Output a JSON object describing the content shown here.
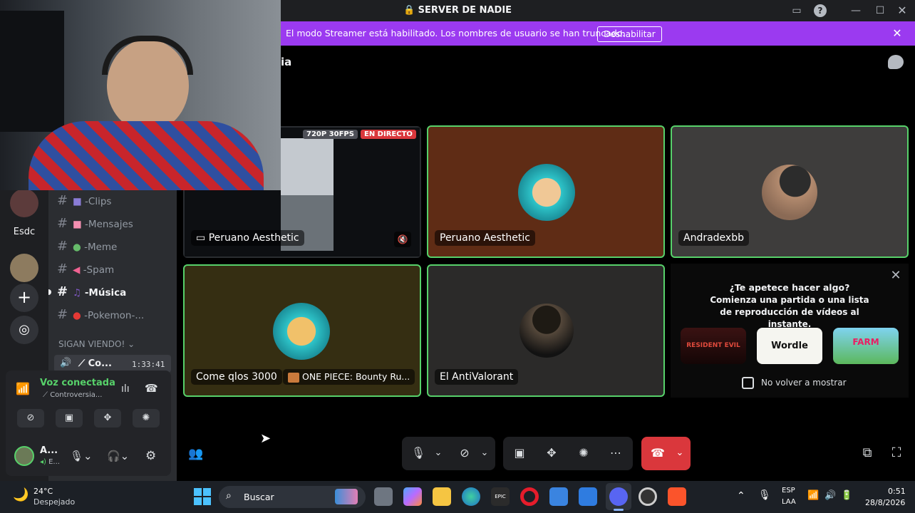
{
  "window": {
    "title": "SERVER DE NADIE"
  },
  "banner": {
    "text": "El modo Streamer está habilitado. Los nombres de usuario se han truncado.",
    "button": "Deshabilitar"
  },
  "header": {
    "channel_partial": "ia"
  },
  "channels": [
    {
      "emoji_color": "#8a7cd6",
      "label": "-Clips"
    },
    {
      "emoji_color": "#f48fb1",
      "label": "-Mensajes"
    },
    {
      "emoji_color": "#66bb6a",
      "label": "-Meme"
    },
    {
      "emoji_color": "#f06292",
      "label": "-Spam"
    },
    {
      "emoji_color": "#7e57c2",
      "label": "-Música"
    },
    {
      "emoji_color": "#e53935",
      "label": "-Pokemon-..."
    }
  ],
  "guild_short": "Esdc",
  "category": "SIGAN VIENDO!",
  "voice_channel": {
    "label": "Co...",
    "timer": "1:33:41"
  },
  "voice_status": {
    "title": "Voz conectada",
    "channel": "Controversia..."
  },
  "user": {
    "name": "A...",
    "status": "E..."
  },
  "tiles": [
    {
      "name": "Peruano Aesthetic",
      "badge_res": "720P 30FPS",
      "badge_live": "EN DIRECTO"
    },
    {
      "name": "Peruano Aesthetic"
    },
    {
      "name": "Andradexbb"
    },
    {
      "name": "Come qlos 3000",
      "activity": "ONE PIECE: Bounty Ru..."
    },
    {
      "name": "El AntiValorant"
    }
  ],
  "activity_panel": {
    "title": "¿Te apetece hacer algo?",
    "subtitle": "Comienza una partida o una lista de reproducción de vídeos al instante.",
    "games": [
      "RESIDENT EVIL",
      "Wordle",
      "FARM"
    ],
    "checkbox": "No volver a mostrar"
  },
  "taskbar": {
    "weather_temp": "24°C",
    "weather_desc": "Despejado",
    "search": "Buscar",
    "lang1": "ESP",
    "lang2": "LAA",
    "time": "0:51",
    "date": "28/8/2026"
  },
  "colors": {
    "accent": "#9b3af0",
    "speaking": "#57d16a",
    "hangup": "#da373c"
  }
}
